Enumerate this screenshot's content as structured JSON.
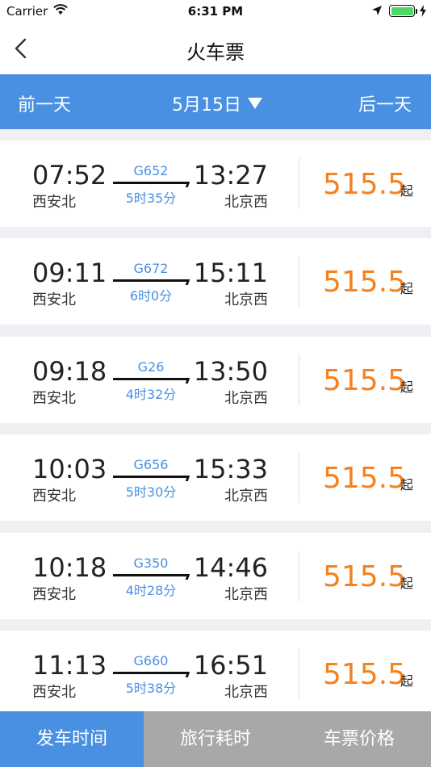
{
  "status_bar": {
    "carrier": "Carrier",
    "time": "6:31 PM",
    "battery_level": 1.0
  },
  "nav": {
    "title": "火车票",
    "back_icon": "chevron-left-icon"
  },
  "date_bar": {
    "prev_label": "前一天",
    "date": "5月15日",
    "next_label": "后一天"
  },
  "trains": [
    {
      "dep_time": "07:52",
      "dep_station": "西安北",
      "train_no": "G652",
      "duration": "5时35分",
      "arr_time": "13:27",
      "arr_station": "北京西",
      "price": "515.5",
      "price_suffix": "起"
    },
    {
      "dep_time": "09:11",
      "dep_station": "西安北",
      "train_no": "G672",
      "duration": "6时0分",
      "arr_time": "15:11",
      "arr_station": "北京西",
      "price": "515.5",
      "price_suffix": "起"
    },
    {
      "dep_time": "09:18",
      "dep_station": "西安北",
      "train_no": "G26",
      "duration": "4时32分",
      "arr_time": "13:50",
      "arr_station": "北京西",
      "price": "515.5",
      "price_suffix": "起"
    },
    {
      "dep_time": "10:03",
      "dep_station": "西安北",
      "train_no": "G656",
      "duration": "5时30分",
      "arr_time": "15:33",
      "arr_station": "北京西",
      "price": "515.5",
      "price_suffix": "起"
    },
    {
      "dep_time": "10:18",
      "dep_station": "西安北",
      "train_no": "G350",
      "duration": "4时28分",
      "arr_time": "14:46",
      "arr_station": "北京西",
      "price": "515.5",
      "price_suffix": "起"
    },
    {
      "dep_time": "11:13",
      "dep_station": "西安北",
      "train_no": "G660",
      "duration": "5时38分",
      "arr_time": "16:51",
      "arr_station": "北京西",
      "price": "515.5",
      "price_suffix": "起"
    }
  ],
  "tabs": [
    {
      "label": "发车时间",
      "active": true
    },
    {
      "label": "旅行耗时",
      "active": false
    },
    {
      "label": "车票价格",
      "active": false
    }
  ],
  "colors": {
    "accent": "#4a90e2",
    "price": "#f5821f",
    "tab_inactive": "#a8a8a8",
    "background": "#efeff4"
  }
}
